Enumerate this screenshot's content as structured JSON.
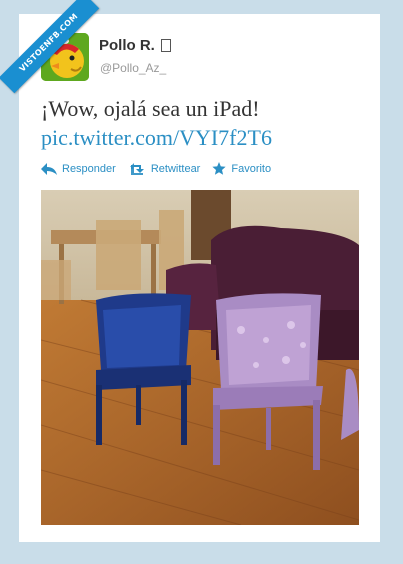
{
  "watermark": "VISTOENFB.COM",
  "user": {
    "name": "Pollo R.",
    "handle": "@Pollo_Az_"
  },
  "tweet": {
    "text": "¡Wow, ojalá sea un iPad!",
    "link": "pic.twitter.com/VYI7f2T6"
  },
  "actions": [
    {
      "label": "Responder",
      "icon": "reply-icon"
    },
    {
      "label": "Retwittear",
      "icon": "retweet-icon"
    },
    {
      "label": "Favorito",
      "icon": "star-icon"
    }
  ],
  "colors": {
    "background": "#c9dde9",
    "link": "#2b8fc4",
    "ribbon": "#1a8fd1"
  }
}
